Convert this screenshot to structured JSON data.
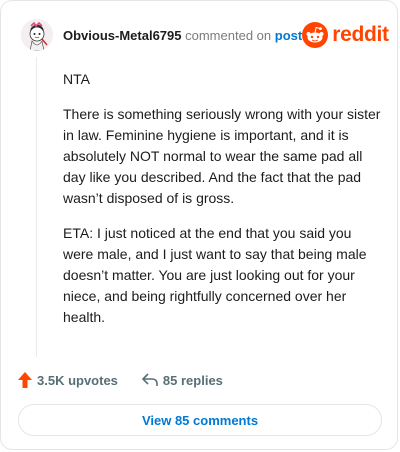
{
  "comment": {
    "author": "Obvious-Metal6795",
    "action_text": "commented on",
    "post_link": "post",
    "brand": "reddit",
    "paragraphs": [
      "NTA",
      "There is something seriously wrong with your sister in law. Feminine hygiene is important, and it is absolutely NOT normal to wear the same pad all day like you described. And the fact that the pad wasn’t disposed of is gross.",
      "ETA: I just noticed at the end that you said you were male, and I just want to say that being male doesn’t matter. You are just looking out for your niece, and being rightfully concerned over her health."
    ]
  },
  "actions": {
    "upvotes": "3.5K upvotes",
    "replies": "85 replies"
  },
  "footer": {
    "view_comments": "View 85 comments"
  },
  "icons": {
    "upvote": "upvote-arrow-icon",
    "reply": "reply-arrow-icon",
    "brand": "reddit-snoo-icon",
    "avatar": "user-avatar"
  },
  "colors": {
    "brand": "#ff4500",
    "link": "#0079d3",
    "upvote": "#ff4500",
    "muted": "#576f76"
  }
}
